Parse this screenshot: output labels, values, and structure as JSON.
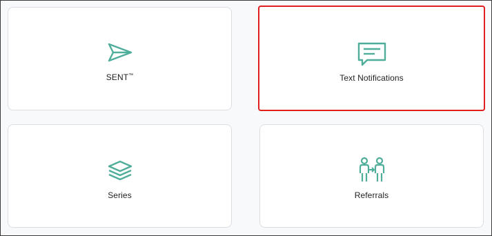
{
  "colors": {
    "icon": "#4fae9a",
    "selected_border": "#e01e1e",
    "card_border": "#dcdee3",
    "background": "#f8f9fb"
  },
  "cards": [
    {
      "label": "SENT",
      "trademark": "™",
      "icon": "send-icon",
      "selected": false
    },
    {
      "label": "Text Notifications",
      "icon": "message-icon",
      "selected": true
    },
    {
      "label": "Series",
      "icon": "layers-icon",
      "selected": false
    },
    {
      "label": "Referrals",
      "icon": "referral-icon",
      "selected": false
    }
  ]
}
